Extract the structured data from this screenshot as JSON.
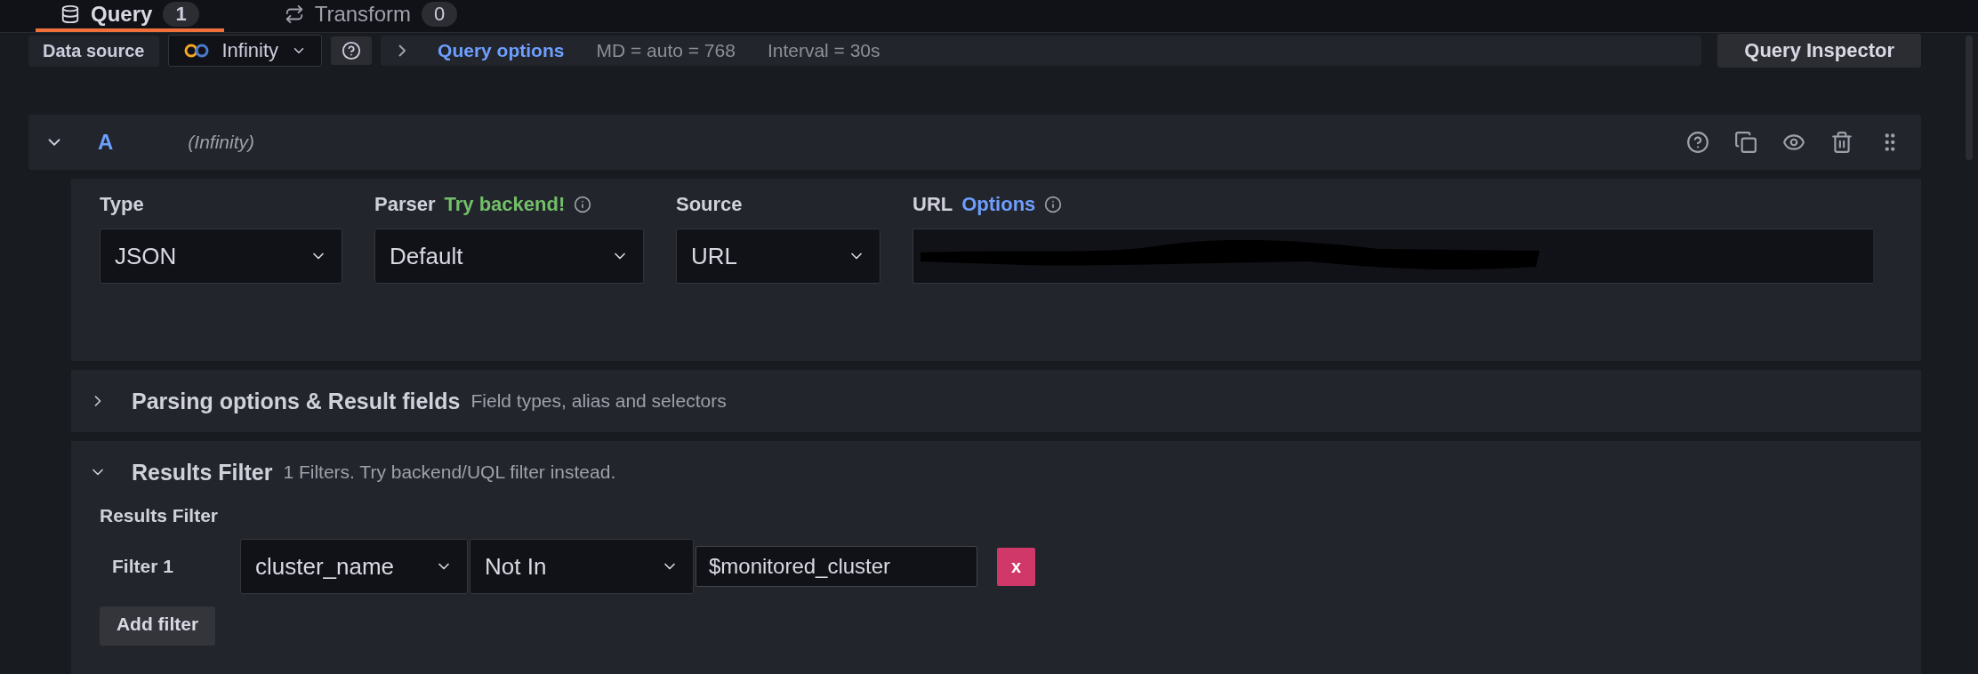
{
  "tabs": [
    {
      "label": "Query",
      "count": "1",
      "selected": true
    },
    {
      "label": "Transform",
      "count": "0",
      "selected": false
    }
  ],
  "toolbar": {
    "data_source_label": "Data source",
    "data_source": "Infinity",
    "query_options": "Query options",
    "max_data_points": "MD = auto = 768",
    "interval": "Interval = 30s",
    "inspector": "Query Inspector"
  },
  "query": {
    "ref": "A",
    "datasource": "(Infinity)",
    "expanded": true,
    "fields": [
      {
        "kind": "select",
        "label": "Type",
        "value": "JSON"
      },
      {
        "kind": "select",
        "label": "Parser",
        "hint": "Try backend!",
        "info": true,
        "value": "Default"
      },
      {
        "kind": "select",
        "label": "Source",
        "value": "URL"
      },
      {
        "kind": "url",
        "label": "URL",
        "link": "Options",
        "info": true
      }
    ]
  },
  "sections": [
    {
      "title": "Parsing options & Result fields",
      "description": "Field types, alias and selectors",
      "expanded": false
    },
    {
      "title": "Results Filter",
      "description": "1 Filters. Try backend/UQL filter instead.",
      "expanded": true
    }
  ],
  "results_filter": {
    "heading": "Results Filter",
    "filters": [
      {
        "label": "Filter 1",
        "field": "cluster_name",
        "operator": "Not In",
        "value": "$monitored_cluster",
        "remove": "x"
      }
    ],
    "add": "Add filter"
  }
}
